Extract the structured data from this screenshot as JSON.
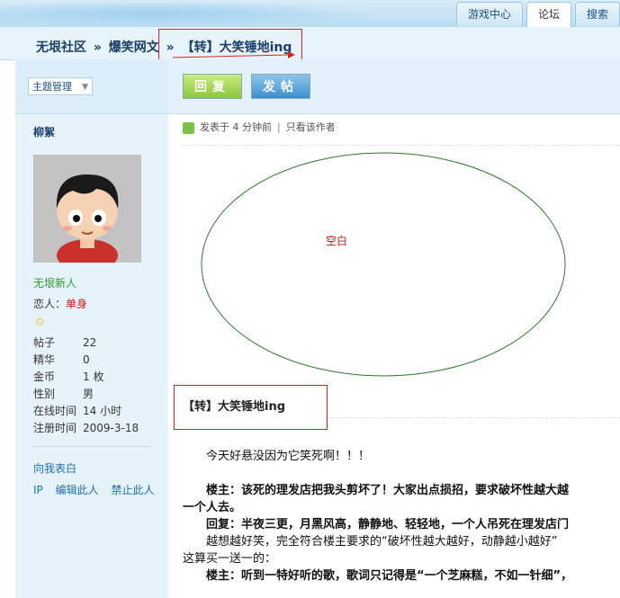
{
  "header": {
    "tabs": [
      "游戏中心",
      "论坛",
      "搜索"
    ],
    "active_tab": "论坛",
    "breadcrumb": [
      "无垠社区",
      "爆笑网文",
      "【转】大笑锤地ing"
    ],
    "separator": "»"
  },
  "left": {
    "topic_mgmt_label": "主题管理",
    "username": "柳絮",
    "rank": "无垠新人",
    "lover_label": "恋人：",
    "lover_value": "单身",
    "stats": [
      {
        "k": "帖子",
        "v": "22"
      },
      {
        "k": "精华",
        "v": "0"
      },
      {
        "k": "金币",
        "v": "1 枚"
      },
      {
        "k": "性别",
        "v": "男"
      },
      {
        "k": "在线时间",
        "v": "14 小时"
      },
      {
        "k": "注册时间",
        "v": "2009-3-18"
      }
    ],
    "pm_label": "向我表白",
    "actions": [
      "IP",
      "编辑此人",
      "禁止此人"
    ]
  },
  "main": {
    "reply_label": "回复",
    "post_label": "发帖",
    "meta_posted": "发表于 4 分钟前",
    "meta_author_only": "只看该作者",
    "blank_label": "空白",
    "post_title": "【转】大笑锤地ing",
    "content": [
      "　　今天好悬没因为它笑死啊！！！",
      "",
      "　　楼主：该死的理发店把我头剪坏了！大家出点损招，要求破坏性越大越",
      "一个人去。",
      "　　回复：半夜三更，月黑风高，静静地、轻轻地，一个人吊死在理发店门",
      "　　越想越好笑，完全符合楼主要求的“破坏性越大越好，动静越小越好”",
      "这算买一送一的：",
      "　　楼主：听到一特好听的歌，歌词只记得是“一个芝麻糕，不如一针细”，"
    ]
  },
  "colors": {
    "accent": "#1b3f6b",
    "red_box": "#e02020",
    "ellipse": "#2a7a2a"
  }
}
